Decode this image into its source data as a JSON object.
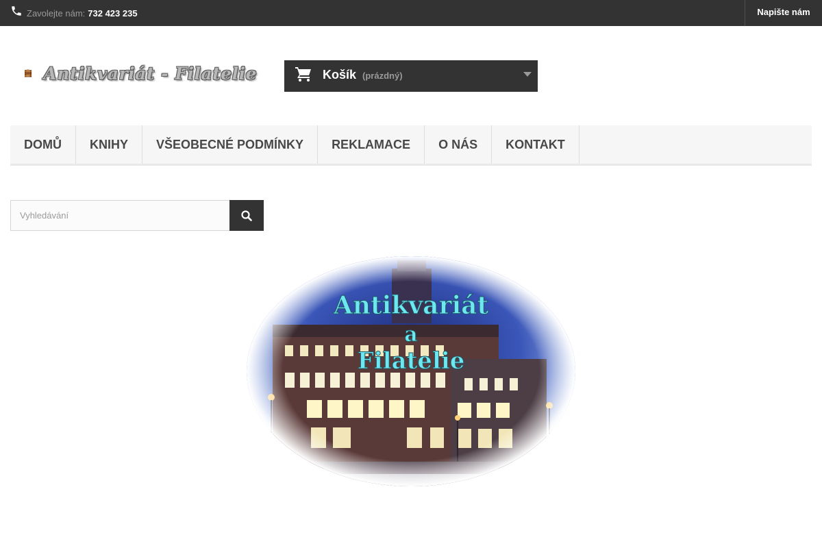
{
  "topbar": {
    "call_label": "Zavolejte nám:",
    "phone_number": "732 423 235",
    "contact_label": "Napište nám"
  },
  "logo": {
    "text": "Antikvariát - Filatelie"
  },
  "cart": {
    "title": "Košík",
    "state": "(prázdný)"
  },
  "menu": {
    "items": [
      {
        "label": "Domů"
      },
      {
        "label": "Knihy"
      },
      {
        "label": "Všeobecné podmínky"
      },
      {
        "label": "Reklamace"
      },
      {
        "label": "O nás"
      },
      {
        "label": "Kontakt"
      }
    ]
  },
  "search": {
    "placeholder": "Vyhledávání"
  },
  "banner": {
    "line1": "Antikvariát",
    "line2": "a",
    "line3": "Filatelie"
  },
  "colors": {
    "dark_bar": "#333333",
    "menu_bg": "#f6f6f6",
    "banner_text": "#6ee8f0"
  }
}
